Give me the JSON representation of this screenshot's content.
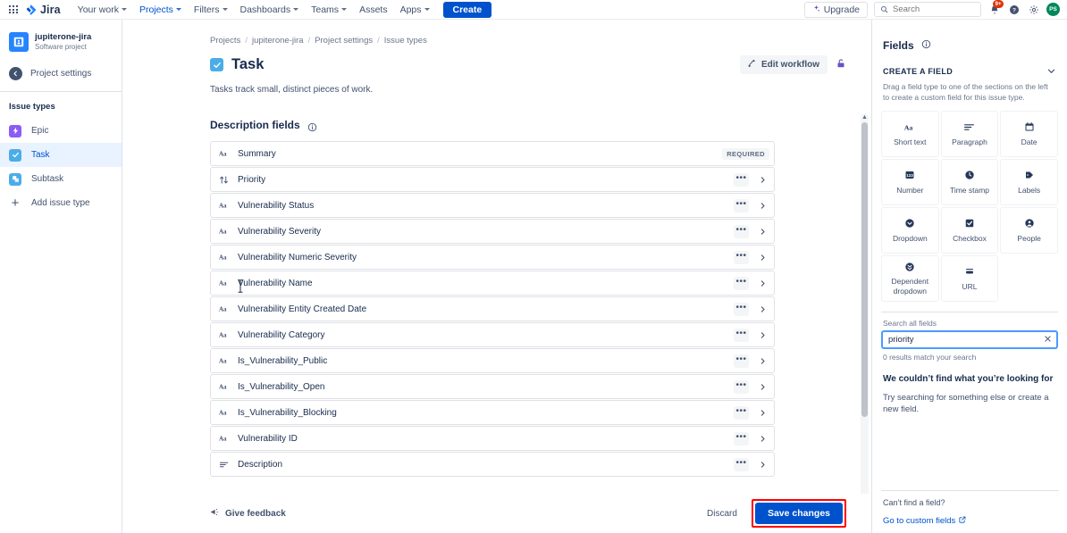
{
  "topnav": {
    "app_switcher": "app-switcher",
    "logo_text": "Jira",
    "items": [
      {
        "label": "Your work",
        "caret": true,
        "active": false
      },
      {
        "label": "Projects",
        "caret": true,
        "active": true
      },
      {
        "label": "Filters",
        "caret": true,
        "active": false
      },
      {
        "label": "Dashboards",
        "caret": true,
        "active": false
      },
      {
        "label": "Teams",
        "caret": true,
        "active": false
      },
      {
        "label": "Assets",
        "caret": false,
        "active": false
      },
      {
        "label": "Apps",
        "caret": true,
        "active": false
      }
    ],
    "create_label": "Create",
    "upgrade_label": "Upgrade",
    "search_placeholder": "Search",
    "notifications_badge": "9+",
    "avatar_initials": "PS",
    "accent": "#0052cc"
  },
  "sidebar": {
    "project_name": "jupiterone-jira",
    "project_type": "Software project",
    "back_label": "Project settings",
    "section_title": "Issue types",
    "items": [
      {
        "label": "Epic",
        "icon": "epic-icon",
        "selected": false
      },
      {
        "label": "Task",
        "icon": "task-icon",
        "selected": true
      },
      {
        "label": "Subtask",
        "icon": "subtask-icon",
        "selected": false
      },
      {
        "label": "Add issue type",
        "icon": "plus-icon",
        "selected": false
      }
    ]
  },
  "main": {
    "breadcrumb": [
      "Projects",
      "jupiterone-jira",
      "Project settings",
      "Issue types"
    ],
    "title": "Task",
    "edit_workflow_label": "Edit workflow",
    "lock_icon": "lock-icon",
    "subtitle": "Tasks track small, distinct pieces of work.",
    "section_title": "Description fields",
    "section_info_icon": "info-icon",
    "required_chip": "REQUIRED",
    "fields": [
      {
        "name": "Summary",
        "icon": "short-text-icon",
        "required": true,
        "actions": false
      },
      {
        "name": "Priority",
        "icon": "priority-icon",
        "required": false,
        "actions": true
      },
      {
        "name": "Vulnerability Status",
        "icon": "short-text-icon",
        "required": false,
        "actions": true
      },
      {
        "name": "Vulnerability Severity",
        "icon": "short-text-icon",
        "required": false,
        "actions": true
      },
      {
        "name": "Vulnerability Numeric Severity",
        "icon": "short-text-icon",
        "required": false,
        "actions": true
      },
      {
        "name": "Vulnerability Name",
        "icon": "short-text-icon",
        "required": false,
        "actions": true
      },
      {
        "name": "Vulnerability Entity Created Date",
        "icon": "short-text-icon",
        "required": false,
        "actions": true
      },
      {
        "name": "Vulnerability Category",
        "icon": "short-text-icon",
        "required": false,
        "actions": true
      },
      {
        "name": "Is_Vulnerability_Public",
        "icon": "short-text-icon",
        "required": false,
        "actions": true
      },
      {
        "name": "Is_Vulnerability_Open",
        "icon": "short-text-icon",
        "required": false,
        "actions": true
      },
      {
        "name": "Is_Vulnerability_Blocking",
        "icon": "short-text-icon",
        "required": false,
        "actions": true
      },
      {
        "name": "Vulnerability ID",
        "icon": "short-text-icon",
        "required": false,
        "actions": true
      },
      {
        "name": "Description",
        "icon": "paragraph-icon",
        "required": false,
        "actions": true
      }
    ],
    "more_actions_label": "•••",
    "expand_label": "›",
    "feedback_label": "Give feedback",
    "discard_label": "Discard",
    "save_label": "Save changes",
    "save_highlight_color": "#ff0000"
  },
  "right_panel": {
    "title": "Fields",
    "info_icon": "info-icon",
    "create_section_title": "CREATE A FIELD",
    "create_description": "Drag a field type to one of the sections on the left to create a custom field for this issue type.",
    "field_types": [
      {
        "label": "Short text",
        "icon": "short-text-icon"
      },
      {
        "label": "Paragraph",
        "icon": "paragraph-icon"
      },
      {
        "label": "Date",
        "icon": "calendar-icon"
      },
      {
        "label": "Number",
        "icon": "number-icon"
      },
      {
        "label": "Time stamp",
        "icon": "clock-icon"
      },
      {
        "label": "Labels",
        "icon": "label-icon"
      },
      {
        "label": "Dropdown",
        "icon": "dropdown-icon"
      },
      {
        "label": "Checkbox",
        "icon": "checkbox-icon"
      },
      {
        "label": "People",
        "icon": "person-icon"
      },
      {
        "label": "Dependent dropdown",
        "icon": "dependent-dropdown-icon"
      },
      {
        "label": "URL",
        "icon": "url-icon"
      }
    ],
    "search_label": "Search all fields",
    "search_value": "priority",
    "search_placeholder": "Search all fields",
    "clear_icon": "close-icon",
    "results_text": "0 results match your search",
    "empty_title": "We couldn’t find what you’re looking for",
    "empty_body": "Try searching for something else or create a new field.",
    "footer_question": "Can’t find a field?",
    "footer_link": "Go to custom fields",
    "footer_link_icon": "external-link-icon"
  }
}
